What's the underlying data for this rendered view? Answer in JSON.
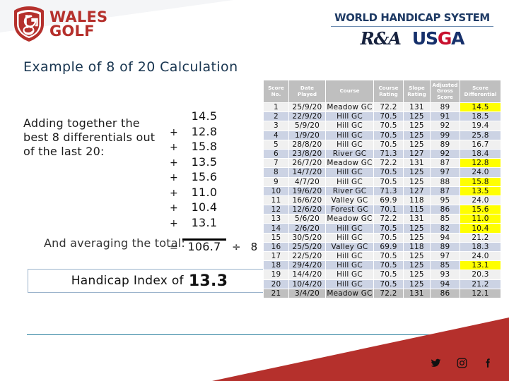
{
  "brand": {
    "wales_golf_line1": "WALES",
    "wales_golf_line2": "GOLF",
    "logo_icon": "wales-golf-shield-icon",
    "accent_red": "#b5302c"
  },
  "whs": {
    "title": "WORLD HANDICAP SYSTEM",
    "ra_mark": "R&A",
    "usga_mark": "USGA",
    "usga_parts": [
      "US",
      "G",
      "A"
    ],
    "navy": "#16306b",
    "red": "#c8102e"
  },
  "page": {
    "title": "Example of 8 of 20 Calculation",
    "title_color": "#17344f"
  },
  "calculation": {
    "intro_text": "Adding together the best 8 differentials out of the last 20:",
    "average_text": "And averaging the total:",
    "operators": [
      "",
      "+",
      "+",
      "+",
      "+",
      "+",
      "+",
      "+"
    ],
    "values": [
      "14.5",
      "12.8",
      "15.8",
      "13.5",
      "15.6",
      "11.0",
      "10.4",
      "13.1"
    ],
    "total_operator": "=",
    "total": "106.7",
    "divide_sign": "÷",
    "divisor": "8"
  },
  "result": {
    "label": "Handicap Index of",
    "value": "13.3"
  },
  "table": {
    "headers": [
      "Score No.",
      "Date Played",
      "Course",
      "Course Rating",
      "Slope Rating",
      "Adjusted Gross Score",
      "Score Differential"
    ],
    "header_lines": [
      [
        "Score",
        "No."
      ],
      [
        "Date",
        "Played"
      ],
      [
        "Course"
      ],
      [
        "Course",
        "Rating"
      ],
      [
        "Slope",
        "Rating"
      ],
      [
        "Adjusted",
        "Gross",
        "Score"
      ],
      [
        "Score",
        "Differential"
      ]
    ],
    "highlight_color": "#ffff00",
    "rows": [
      {
        "no": "1",
        "date": "25/9/20",
        "course": "Meadow GC",
        "course_rating": "72.2",
        "slope_rating": "131",
        "ags": "89",
        "differential": "14.5",
        "highlight": true,
        "excluded": false
      },
      {
        "no": "2",
        "date": "22/9/20",
        "course": "Hill GC",
        "course_rating": "70.5",
        "slope_rating": "125",
        "ags": "91",
        "differential": "18.5",
        "highlight": false,
        "excluded": false
      },
      {
        "no": "3",
        "date": "5/9/20",
        "course": "Hill GC",
        "course_rating": "70.5",
        "slope_rating": "125",
        "ags": "92",
        "differential": "19.4",
        "highlight": false,
        "excluded": false
      },
      {
        "no": "4",
        "date": "1/9/20",
        "course": "Hill GC",
        "course_rating": "70.5",
        "slope_rating": "125",
        "ags": "99",
        "differential": "25.8",
        "highlight": false,
        "excluded": false
      },
      {
        "no": "5",
        "date": "28/8/20",
        "course": "Hill GC",
        "course_rating": "70.5",
        "slope_rating": "125",
        "ags": "89",
        "differential": "16.7",
        "highlight": false,
        "excluded": false
      },
      {
        "no": "6",
        "date": "23/8/20",
        "course": "River GC",
        "course_rating": "71.3",
        "slope_rating": "127",
        "ags": "92",
        "differential": "18.4",
        "highlight": false,
        "excluded": false
      },
      {
        "no": "7",
        "date": "26/7/20",
        "course": "Meadow GC",
        "course_rating": "72.2",
        "slope_rating": "131",
        "ags": "87",
        "differential": "12.8",
        "highlight": true,
        "excluded": false
      },
      {
        "no": "8",
        "date": "14/7/20",
        "course": "Hill GC",
        "course_rating": "70.5",
        "slope_rating": "125",
        "ags": "97",
        "differential": "24.0",
        "highlight": false,
        "excluded": false
      },
      {
        "no": "9",
        "date": "4/7/20",
        "course": "Hill GC",
        "course_rating": "70.5",
        "slope_rating": "125",
        "ags": "88",
        "differential": "15.8",
        "highlight": true,
        "excluded": false
      },
      {
        "no": "10",
        "date": "19/6/20",
        "course": "River GC",
        "course_rating": "71.3",
        "slope_rating": "127",
        "ags": "87",
        "differential": "13.5",
        "highlight": true,
        "excluded": false
      },
      {
        "no": "11",
        "date": "16/6/20",
        "course": "Valley GC",
        "course_rating": "69.9",
        "slope_rating": "118",
        "ags": "95",
        "differential": "24.0",
        "highlight": false,
        "excluded": false
      },
      {
        "no": "12",
        "date": "12/6/20",
        "course": "Forest GC",
        "course_rating": "70.1",
        "slope_rating": "115",
        "ags": "86",
        "differential": "15.6",
        "highlight": true,
        "excluded": false
      },
      {
        "no": "13",
        "date": "5/6/20",
        "course": "Meadow GC",
        "course_rating": "72.2",
        "slope_rating": "131",
        "ags": "85",
        "differential": "11.0",
        "highlight": true,
        "excluded": false
      },
      {
        "no": "14",
        "date": "2/6/20",
        "course": "Hill GC",
        "course_rating": "70.5",
        "slope_rating": "125",
        "ags": "82",
        "differential": "10.4",
        "highlight": true,
        "excluded": false
      },
      {
        "no": "15",
        "date": "30/5/20",
        "course": "Hill GC",
        "course_rating": "70.5",
        "slope_rating": "125",
        "ags": "94",
        "differential": "21.2",
        "highlight": false,
        "excluded": false
      },
      {
        "no": "16",
        "date": "25/5/20",
        "course": "Valley GC",
        "course_rating": "69.9",
        "slope_rating": "118",
        "ags": "89",
        "differential": "18.3",
        "highlight": false,
        "excluded": false
      },
      {
        "no": "17",
        "date": "22/5/20",
        "course": "Hill GC",
        "course_rating": "70.5",
        "slope_rating": "125",
        "ags": "97",
        "differential": "24.0",
        "highlight": false,
        "excluded": false
      },
      {
        "no": "18",
        "date": "29/4/20",
        "course": "Hill GC",
        "course_rating": "70.5",
        "slope_rating": "125",
        "ags": "85",
        "differential": "13.1",
        "highlight": true,
        "excluded": false
      },
      {
        "no": "19",
        "date": "14/4/20",
        "course": "Hill GC",
        "course_rating": "70.5",
        "slope_rating": "125",
        "ags": "93",
        "differential": "20.3",
        "highlight": false,
        "excluded": false
      },
      {
        "no": "20",
        "date": "10/4/20",
        "course": "Hill GC",
        "course_rating": "70.5",
        "slope_rating": "125",
        "ags": "94",
        "differential": "21.2",
        "highlight": false,
        "excluded": false
      },
      {
        "no": "21",
        "date": "3/4/20",
        "course": "Meadow GC",
        "course_rating": "72.2",
        "slope_rating": "131",
        "ags": "86",
        "differential": "12.1",
        "highlight": false,
        "excluded": true
      }
    ]
  },
  "footer": {
    "rule_color": "#2a7f9e",
    "wedge_color": "#b5302c",
    "social": [
      {
        "icon": "twitter-icon"
      },
      {
        "icon": "instagram-icon"
      },
      {
        "icon": "facebook-icon"
      }
    ]
  }
}
